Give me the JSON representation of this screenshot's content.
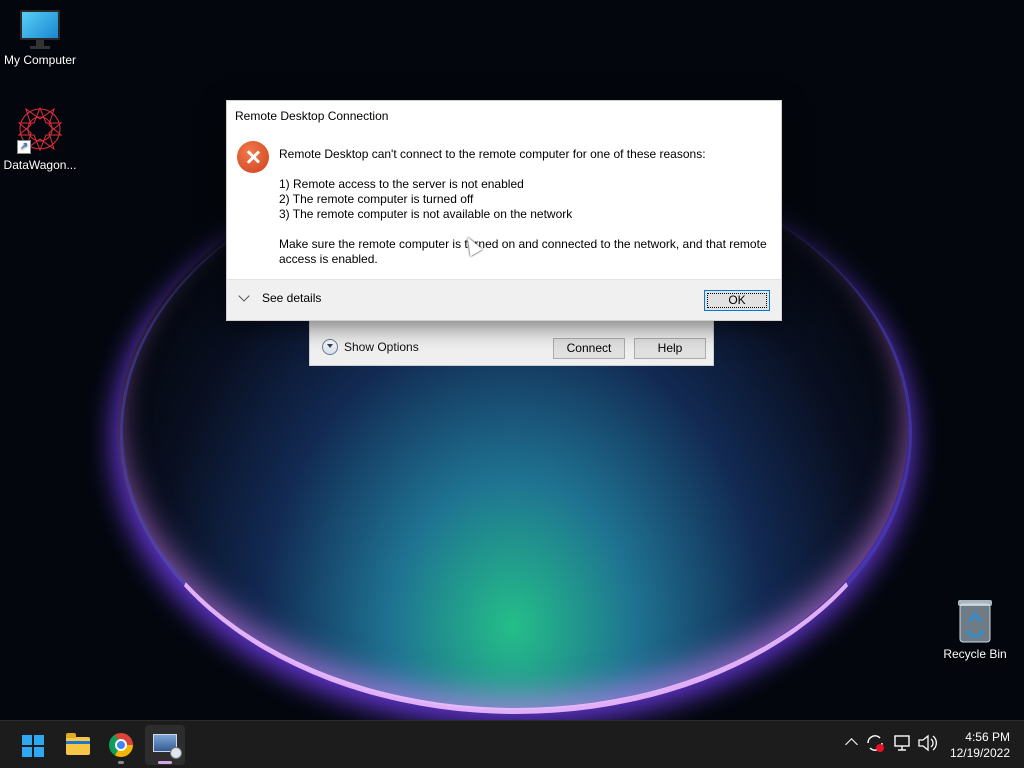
{
  "desktop": {
    "icons": [
      {
        "label": "My Computer",
        "icon": "monitor-icon"
      },
      {
        "label": "DataWagon...",
        "icon": "star-shortcut-icon"
      },
      {
        "label": "Recycle Bin",
        "icon": "recycle-bin-icon"
      }
    ]
  },
  "rdc_window": {
    "show_options_label": "Show Options",
    "connect_label": "Connect",
    "help_label": "Help"
  },
  "error_dialog": {
    "title": "Remote Desktop Connection",
    "icon": "error-icon",
    "heading": "Remote Desktop can't connect to the remote computer for one of these reasons:",
    "reasons": [
      "1) Remote access to the server is not enabled",
      "2) The remote computer is turned off",
      "3) The remote computer is not available on the network"
    ],
    "advice": "Make sure the remote computer is turned on and connected to the network, and that remote access is enabled.",
    "see_details_label": "See details",
    "ok_label": "OK"
  },
  "taskbar": {
    "apps": [
      "start-icon",
      "file-explorer-icon",
      "chrome-icon",
      "remote-desktop-icon"
    ],
    "active_app": "remote-desktop-icon",
    "clock": {
      "time": "4:56 PM",
      "date": "12/19/2022"
    }
  },
  "colors": {
    "accent": "#0078d7",
    "error": "#d1401a",
    "taskbar": "#1c1c1c"
  }
}
